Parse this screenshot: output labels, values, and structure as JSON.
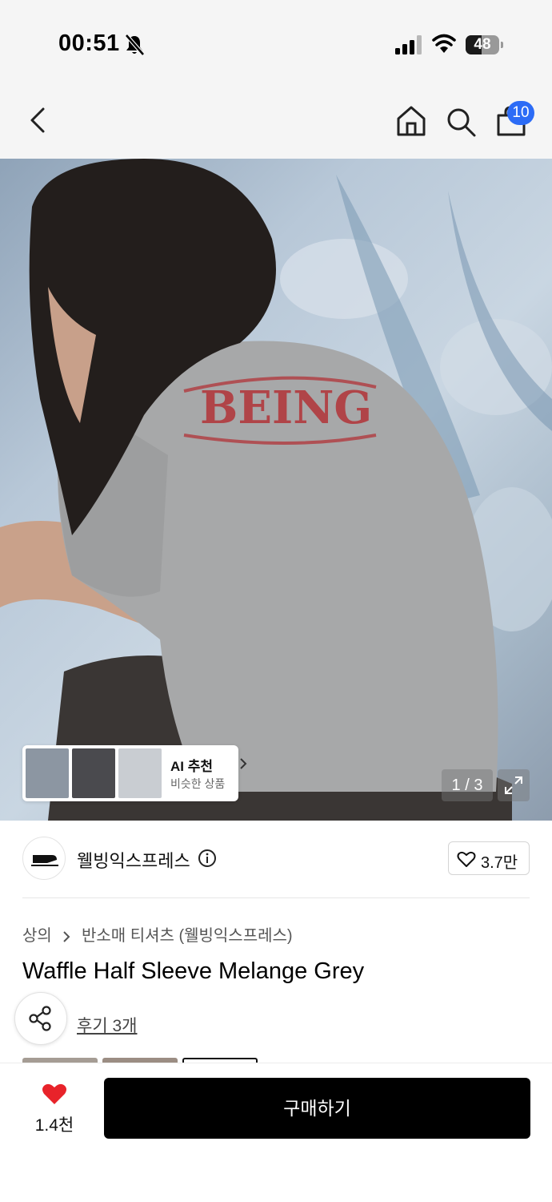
{
  "status_bar": {
    "time": "00:51",
    "battery": "48",
    "battery_level": 0.48
  },
  "nav": {
    "cart_count": "10",
    "icons": [
      "back-icon",
      "home-icon",
      "search-icon",
      "cart-icon"
    ]
  },
  "gallery": {
    "counter": "1 / 3",
    "recommendation": {
      "title": "AI 추천",
      "subtitle": "비슷한 상품",
      "thumb_colors": [
        "#8c96a2",
        "#4a4a4e",
        "#c9cdd2"
      ]
    }
  },
  "brand": {
    "name": "웰빙익스프레스",
    "likes": "3.7만"
  },
  "category": {
    "crumbs": [
      "상의",
      "반소매 티셔츠 (웰빙익스프레스)"
    ]
  },
  "product": {
    "title": "Waffle Half Sleeve Melange Grey",
    "review_link": "후기 3개"
  },
  "bottom": {
    "wish_count": "1.4천",
    "buy_label": "구매하기"
  },
  "colors": {
    "accent_blue": "#2c6cf6",
    "heart_red": "#e8232a",
    "buy_black": "#000000"
  }
}
